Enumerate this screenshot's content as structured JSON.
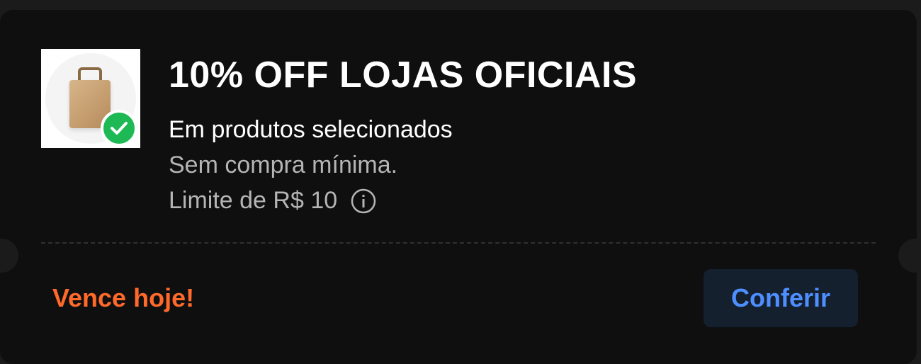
{
  "coupon": {
    "title": "10% OFF LOJAS OFICIAIS",
    "subtitle": "Em produtos selecionados",
    "min_purchase": "Sem compra mínima.",
    "limit": "Limite de R$ 10",
    "expiry": "Vence hoje!",
    "action_label": "Conferir",
    "thumbnail_icon": "shopping-bag-icon",
    "badge_icon": "check-icon",
    "info_icon": "info-icon"
  },
  "colors": {
    "card_background": "#0f0f10",
    "page_background": "#1b1b1b",
    "title": "#ffffff",
    "muted_text": "#b5b5b5",
    "expiry": "#ff6a2b",
    "button_background": "#15202f",
    "button_text": "#4d8fff",
    "badge_green": "#1db954"
  }
}
